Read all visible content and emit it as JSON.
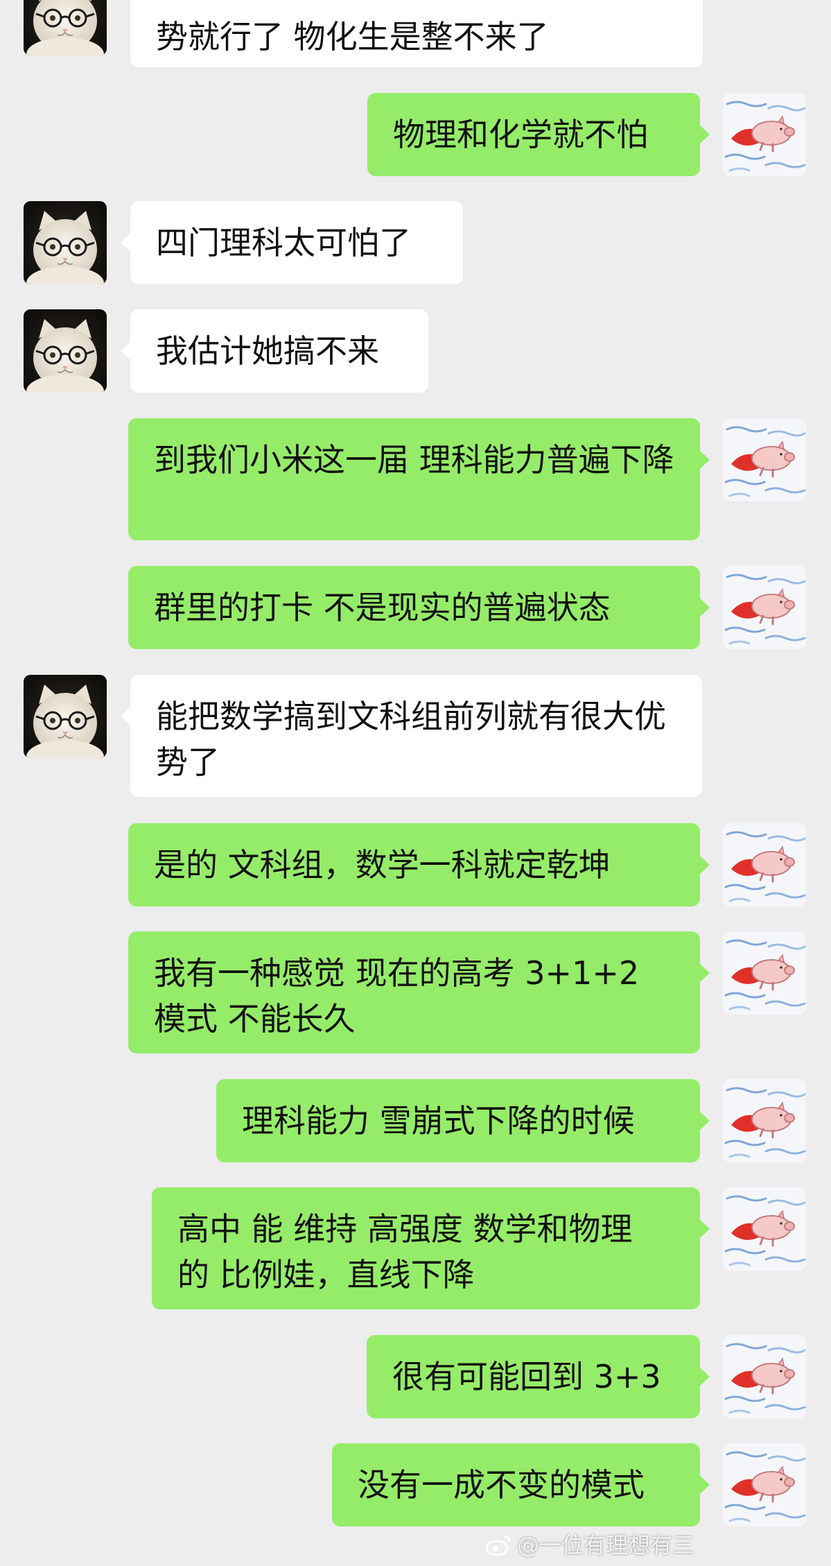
{
  "colors": {
    "background": "#ededed",
    "incoming_bubble": "#ffffff",
    "outgoing_bubble": "#95ec69"
  },
  "avatars": {
    "incoming": "cat-with-glasses-avatar",
    "outgoing": "flying-pig-avatar"
  },
  "messages": [
    {
      "side": "in",
      "text": "势就行了 物化生是整不来了",
      "clipped": true
    },
    {
      "side": "out",
      "text": "物理和化学就不怕"
    },
    {
      "side": "in",
      "text": "四门理科太可怕了"
    },
    {
      "side": "in",
      "text": "我估计她搞不来"
    },
    {
      "side": "out",
      "text": "到我们小米这一届 理科能力普遍下降"
    },
    {
      "side": "out",
      "text": "群里的打卡 不是现实的普遍状态"
    },
    {
      "side": "in",
      "text": "能把数学搞到文科组前列就有很大优势了"
    },
    {
      "side": "out",
      "text": "是的 文科组，数学一科就定乾坤"
    },
    {
      "side": "out",
      "text": "我有一种感觉 现在的高考 3+1+2 模式 不能长久"
    },
    {
      "side": "out",
      "text": "理科能力 雪崩式下降的时候"
    },
    {
      "side": "out",
      "text": "高中 能 维持 高强度 数学和物理 的 比例娃，直线下降"
    },
    {
      "side": "out",
      "text": "很有可能回到 3+3"
    },
    {
      "side": "out",
      "text": "没有一成不变的模式"
    }
  ],
  "watermark": {
    "icon": "weibo-icon",
    "text": "@一位有理想有三"
  }
}
